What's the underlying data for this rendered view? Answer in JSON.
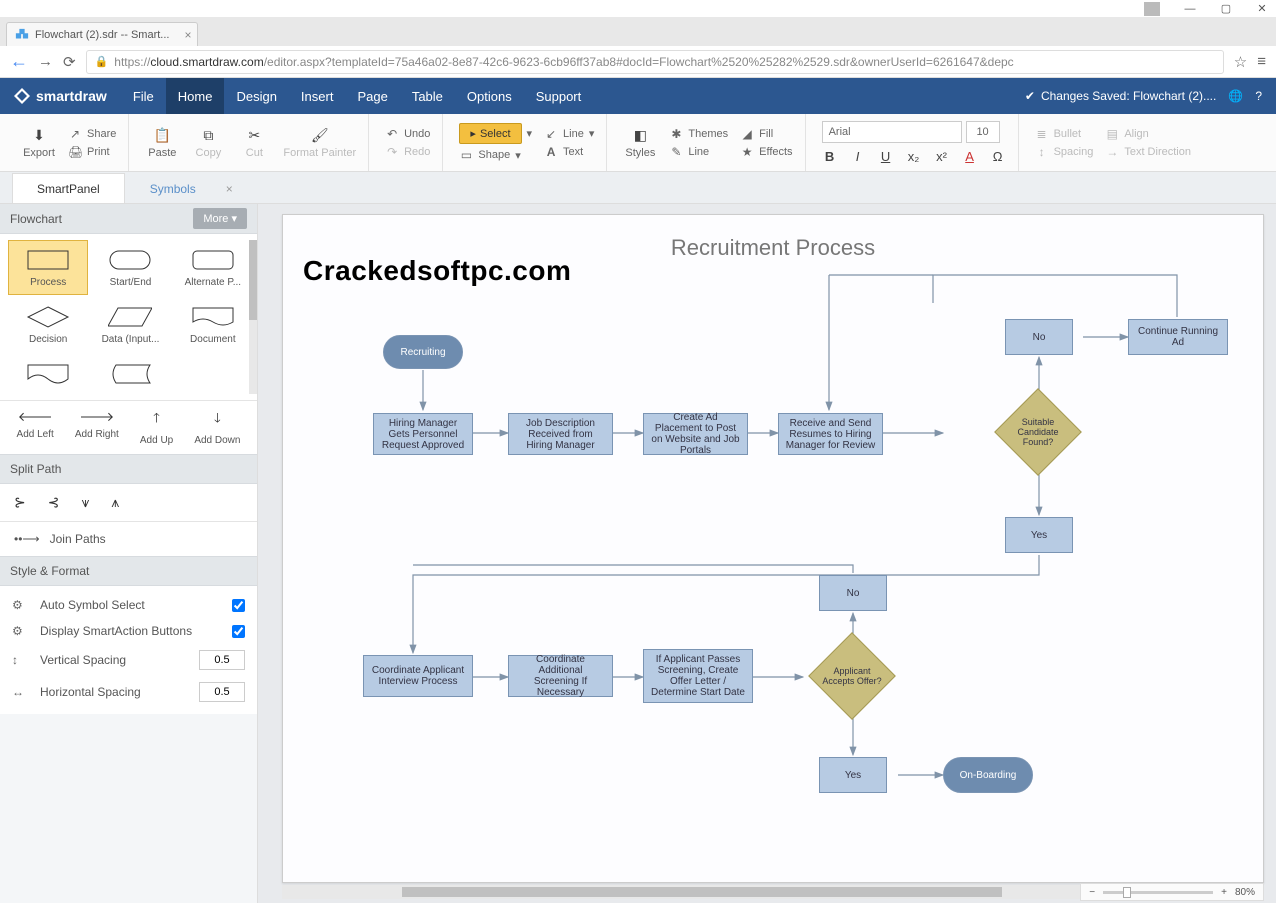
{
  "window": {
    "tab_title": "Flowchart (2).sdr -- Smart..."
  },
  "url": {
    "prefix": "https://",
    "host": "cloud.smartdraw.com",
    "path": "/editor.aspx?templateId=75a46a02-8e87-42c6-9623-6cb96ff37ab8#docId=Flowchart%2520%25282%2529.sdr&ownerUserId=6261647&depc"
  },
  "brand": "smartdraw",
  "menu": [
    "File",
    "Home",
    "Design",
    "Insert",
    "Page",
    "Table",
    "Options",
    "Support"
  ],
  "menu_active": "Home",
  "status_saved": "Changes Saved: Flowchart (2)....",
  "ribbon": {
    "export": "Export",
    "share": "Share",
    "print": "Print",
    "paste": "Paste",
    "copy": "Copy",
    "cut": "Cut",
    "format_painter": "Format Painter",
    "undo": "Undo",
    "redo": "Redo",
    "select": "Select",
    "shape": "Shape",
    "line": "Line",
    "text": "Text",
    "styles": "Styles",
    "themes": "Themes",
    "linebtn": "Line",
    "fill": "Fill",
    "effects": "Effects",
    "font_name": "Arial",
    "font_size": "10",
    "bullet": "Bullet",
    "align": "Align",
    "spacing": "Spacing",
    "direction": "Text Direction"
  },
  "panel_tabs": {
    "smart": "SmartPanel",
    "symbols": "Symbols"
  },
  "sidebar": {
    "header": "Flowchart",
    "more": "More ▾",
    "shapes": [
      "Process",
      "Start/End",
      "Alternate P...",
      "Decision",
      "Data (Input...",
      "Document"
    ],
    "arrows": [
      "Add Left",
      "Add Right",
      "Add Up",
      "Add Down"
    ],
    "split_title": "Split Path",
    "join": "Join Paths",
    "style_title": "Style & Format",
    "auto_symbol": "Auto Symbol Select",
    "smartaction": "Display SmartAction Buttons",
    "vspacing_label": "Vertical Spacing",
    "vspacing": "0.5",
    "hspacing_label": "Horizontal Spacing",
    "hspacing": "0.5"
  },
  "canvas": {
    "title": "Recruitment Process",
    "watermark": "Crackedsoftpc.com",
    "nodes": {
      "recruiting": "Recruiting",
      "hiring_mgr": "Hiring Manager Gets Personnel Request Approved",
      "job_desc": "Job Description Received from Hiring Manager",
      "create_ad": "Create Ad Placement to Post on Website and Job Portals",
      "receive": "Receive and Send Resumes to Hiring Manager for Review",
      "suitable": "Suitable Candidate Found?",
      "no1": "No",
      "continue_ad": "Continue Running Ad",
      "yes1": "Yes",
      "coord_interview": "Coordinate Applicant Interview Process",
      "coord_screen": "Coordinate Additional Screening If Necessary",
      "if_passes": "If Applicant Passes Screening, Create Offer Letter / Determine Start Date",
      "accepts": "Applicant Accepts Offer?",
      "no2": "No",
      "yes2": "Yes",
      "onboard": "On-Boarding"
    }
  },
  "zoom": "80%"
}
